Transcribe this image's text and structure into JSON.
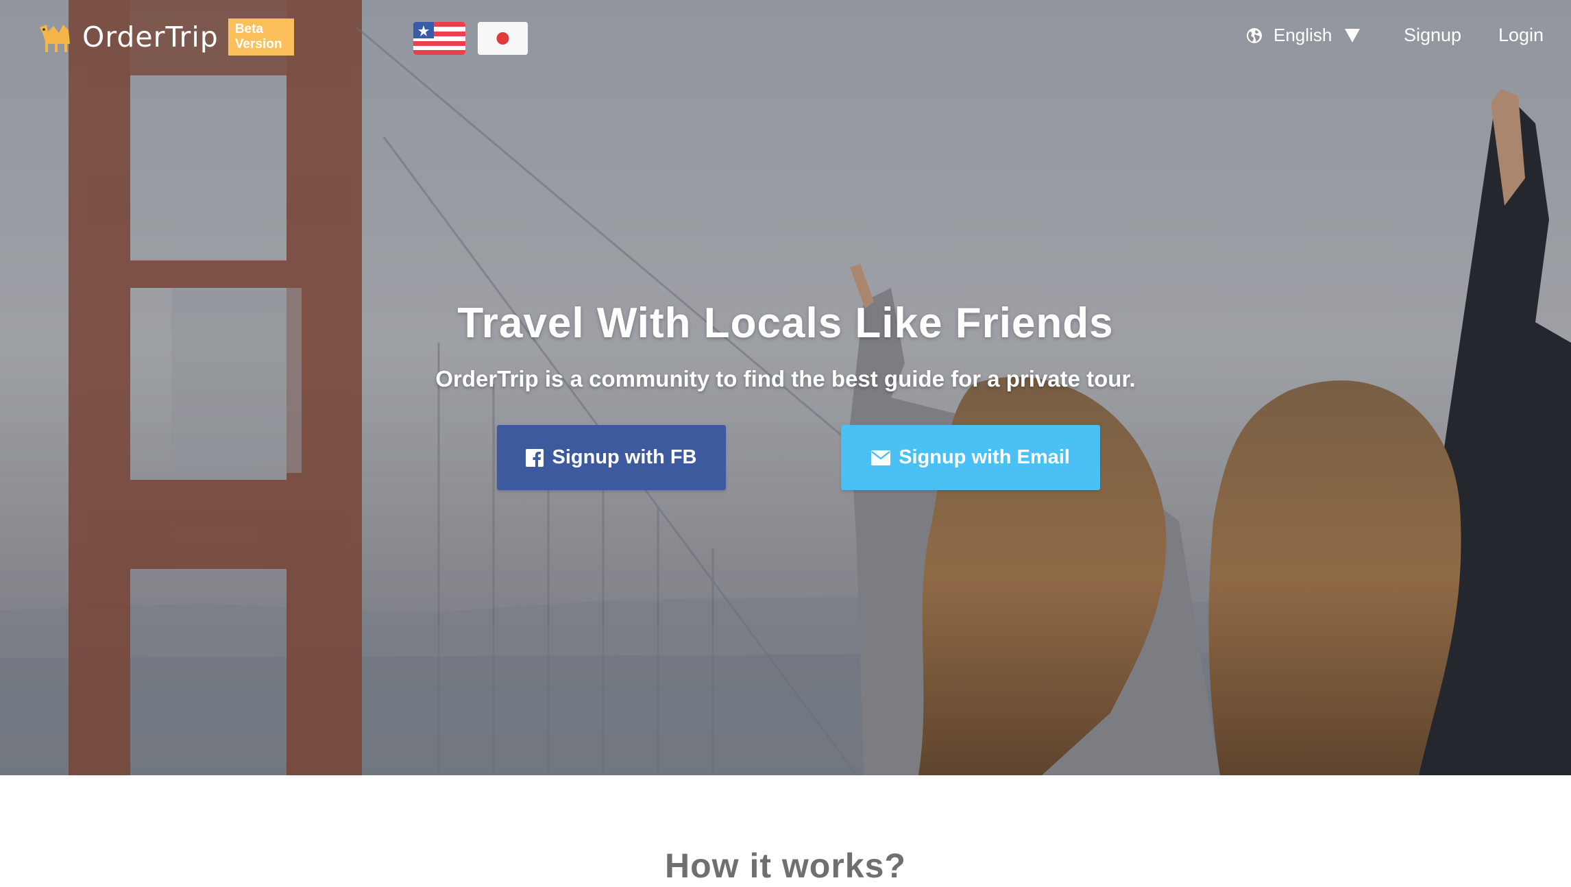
{
  "app": {
    "brand": "OrderTrip",
    "beta_badge_line1": "Beta",
    "beta_badge_line2": "Version"
  },
  "nav": {
    "flags": [
      {
        "name": "us-flag-icon",
        "country": "US"
      },
      {
        "name": "japan-flag-icon",
        "country": "JP"
      }
    ],
    "language": {
      "label": "English",
      "icon": "globe-icon",
      "caret": "caret-down-icon"
    },
    "signup_label": "Signup",
    "login_label": "Login"
  },
  "hero": {
    "title": "Travel With Locals Like Friends",
    "subtitle": "OrderTrip is a community to find the best guide for a private tour.",
    "buttons": {
      "facebook": {
        "label": "Signup with FB",
        "icon": "facebook-icon",
        "color": "#3d5a9e"
      },
      "email": {
        "label": "Signup with Email",
        "icon": "envelope-icon",
        "color": "#4bc0f5"
      }
    }
  },
  "how_it_works": {
    "heading": "How it works?"
  },
  "colors": {
    "beta_badge": "#fbbf5c",
    "heading_gray": "#6f6f6f"
  }
}
